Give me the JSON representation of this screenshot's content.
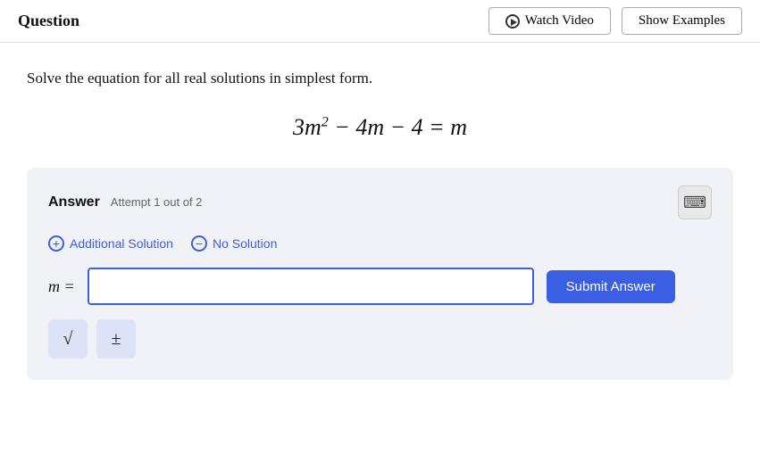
{
  "header": {
    "title": "Question",
    "watch_video_label": "Watch Video",
    "show_examples_label": "Show Examples"
  },
  "main": {
    "instruction": "Solve the equation for all real solutions in simplest form.",
    "equation_display": "3m² − 4m − 4 = m",
    "answer_section": {
      "label": "Answer",
      "attempt_text": "Attempt 1 out of 2",
      "keyboard_icon": "⌨",
      "additional_solution_label": "Additional Solution",
      "no_solution_label": "No Solution",
      "input_label": "m =",
      "input_placeholder": "",
      "submit_label": "Submit Answer",
      "symbol_sqrt": "√",
      "symbol_pm": "±"
    }
  }
}
